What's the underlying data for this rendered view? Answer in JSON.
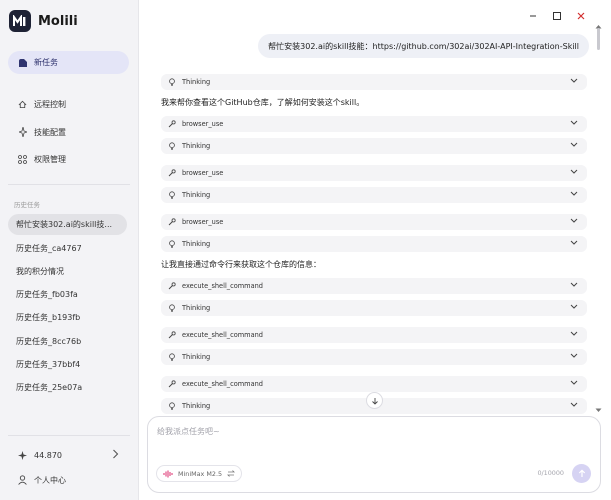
{
  "app": {
    "name": "Molili"
  },
  "sidebar": {
    "new_task": "新任务",
    "nav": [
      {
        "label": "远程控制",
        "icon": "monitor-icon"
      },
      {
        "label": "技能配置",
        "icon": "sparkle-icon"
      },
      {
        "label": "权限管理",
        "icon": "grid-icon"
      }
    ],
    "history_label": "历史任务",
    "history": [
      "帮忙安装302.ai的skill技...",
      "历史任务_ca4767",
      "我的积分情况",
      "历史任务_fb03fa",
      "历史任务_b193fb",
      "历史任务_8cc76b",
      "历史任务_37bbf4",
      "历史任务_25e07a"
    ],
    "credits": "44.870",
    "profile": "个人中心"
  },
  "chat": {
    "user_message": "帮忙安装302.ai的skill技能：https://github.com/302ai/302AI-API-Integration-Skill",
    "ai_text_1": "我来帮你查看这个GitHub仓库，了解如何安装这个skill。",
    "ai_text_2": "让我直接通过命令行来获取这个仓库的信息：",
    "tools": [
      "Thinking",
      "browser_use",
      "Thinking",
      "browser_use",
      "Thinking",
      "browser_use",
      "Thinking",
      "execute_shell_command",
      "Thinking",
      "execute_shell_command",
      "Thinking",
      "execute_shell_command",
      "Thinking"
    ]
  },
  "composer": {
    "placeholder": "给我派点任务吧~",
    "model": "MiniMax M2.5",
    "counter": "0/10000"
  },
  "colors": {
    "accent": "#6c63d9",
    "sidebar_bg": "#f3f3f6",
    "close_red": "#d32f2f"
  }
}
